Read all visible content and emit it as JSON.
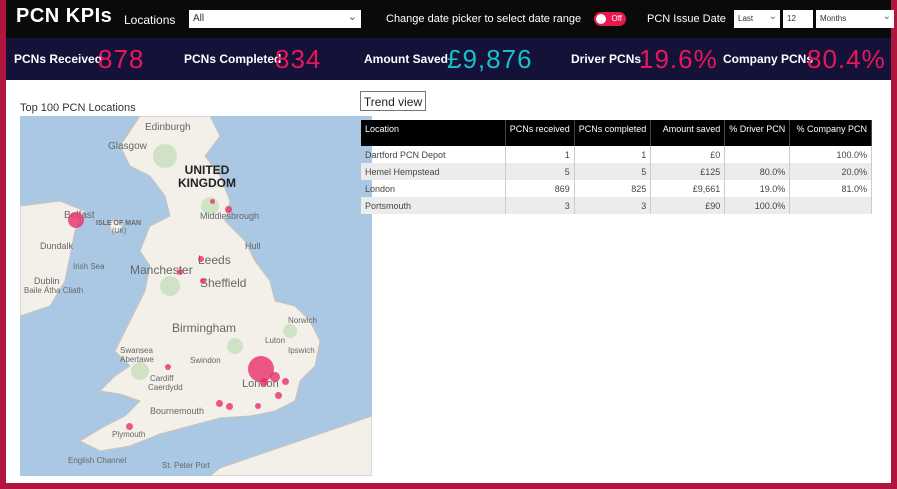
{
  "header": {
    "title": "PCN KPIs",
    "locations_label": "Locations",
    "locations_value": "All",
    "date_picker_label": "Change date picker to select date range",
    "toggle_text": "Off",
    "issue_date_label": "PCN Issue Date",
    "issue_relative": "Last",
    "issue_count": "12",
    "issue_unit": "Months"
  },
  "kpis": {
    "received_label": "PCNs Received",
    "received_value": "878",
    "completed_label": "PCNs Completed",
    "completed_value": "834",
    "saved_label": "Amount Saved",
    "saved_value": "£9,876",
    "driver_label": "Driver PCNs",
    "driver_value": "19.6%",
    "company_label": "Company PCNs",
    "company_value": "80.4%"
  },
  "map": {
    "title": "Top 100 PCN Locations",
    "country_line1": "UNITED",
    "country_line2": "KINGDOM",
    "labels": {
      "edinburgh": "Edinburgh",
      "glasgow": "Glasgow",
      "belfast": "Belfast",
      "isle_of_man": "ISLE OF MAN",
      "isle_of_man_sub": "(UK)",
      "dundalk": "Dundalk",
      "irish_sea": "Irish Sea",
      "dublin": "Dublin",
      "baile_atha_cliath": "Baile Átha Cliath",
      "middlesbrough": "Middlesbrough",
      "leeds": "Leeds",
      "hull": "Hull",
      "manchester": "Manchester",
      "sheffield": "Sheffield",
      "birmingham": "Birmingham",
      "norwich": "Norwich",
      "swansea": "Swansea",
      "abertawe": "Abertawe",
      "swindon": "Swindon",
      "luton": "Luton",
      "ipswich": "Ipswich",
      "cardiff": "Cardiff",
      "caerdydd": "Caerdydd",
      "london": "London",
      "bournemouth": "Bournemouth",
      "plymouth": "Plymouth",
      "english_channel": "English Channel",
      "st_peter_port": "St. Peter Port"
    }
  },
  "trend_button": "Trend view",
  "table": {
    "headers": [
      "Location",
      "PCNs received",
      "PCNs completed",
      "Amount saved",
      "% Driver PCN",
      "% Company PCN"
    ],
    "rows": [
      [
        "Dartford PCN Depot",
        "1",
        "1",
        "£0",
        "",
        "100.0%"
      ],
      [
        "Hemel Hempstead",
        "5",
        "5",
        "£125",
        "80.0%",
        "20.0%"
      ],
      [
        "London",
        "869",
        "825",
        "£9,661",
        "19.0%",
        "81.0%"
      ],
      [
        "Portsmouth",
        "3",
        "3",
        "£90",
        "100.0%",
        ""
      ]
    ]
  },
  "colors": {
    "frame": "#b0153e",
    "header_bg": "#0a0a0a",
    "kpi_bg": "#141238",
    "kpi_pink": "#e8175d",
    "kpi_teal": "#1bbfc9",
    "map_dot": "#e8306a"
  }
}
